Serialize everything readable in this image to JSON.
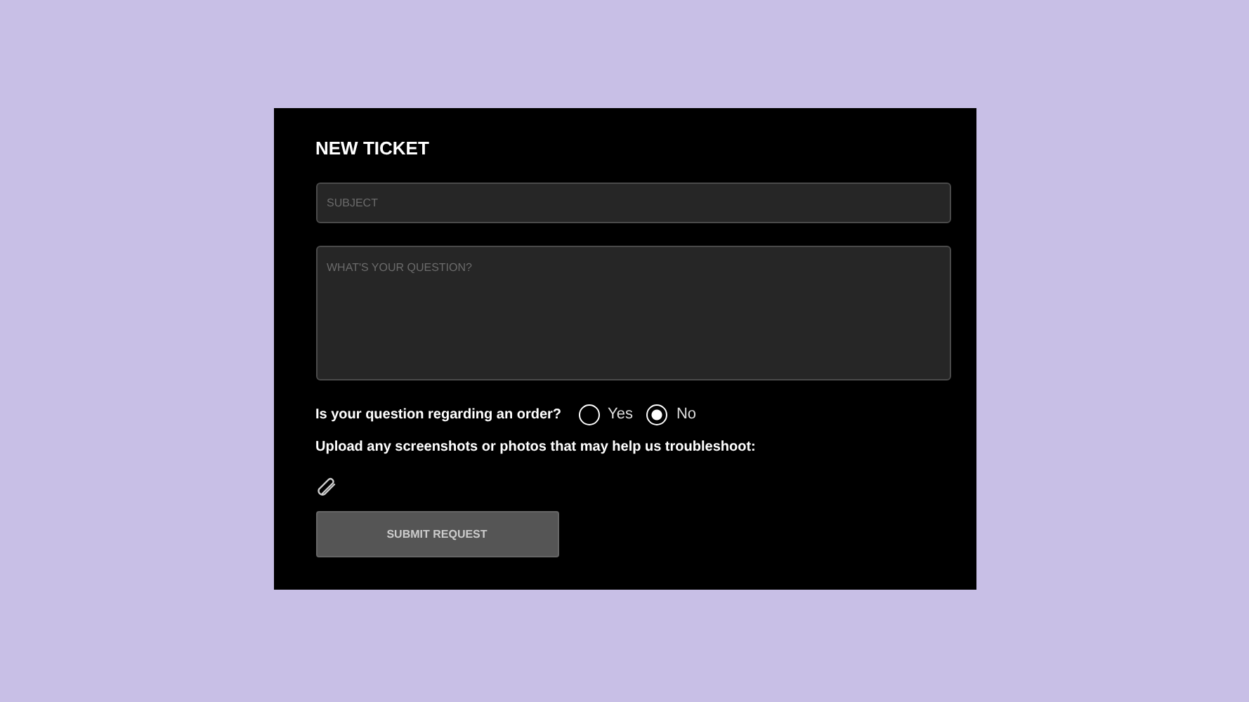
{
  "title": "NEW TICKET",
  "subject": {
    "placeholder": "SUBJECT"
  },
  "question": {
    "placeholder": "WHAT'S YOUR QUESTION?"
  },
  "order_question": {
    "label": "Is your question regarding an order?",
    "options": [
      {
        "label": "Yes",
        "selected": false
      },
      {
        "label": "No",
        "selected": true
      }
    ]
  },
  "upload": {
    "label": "Upload any screenshots or photos that may help us troubleshoot:"
  },
  "submit": {
    "label": "SUBMIT REQUEST"
  }
}
